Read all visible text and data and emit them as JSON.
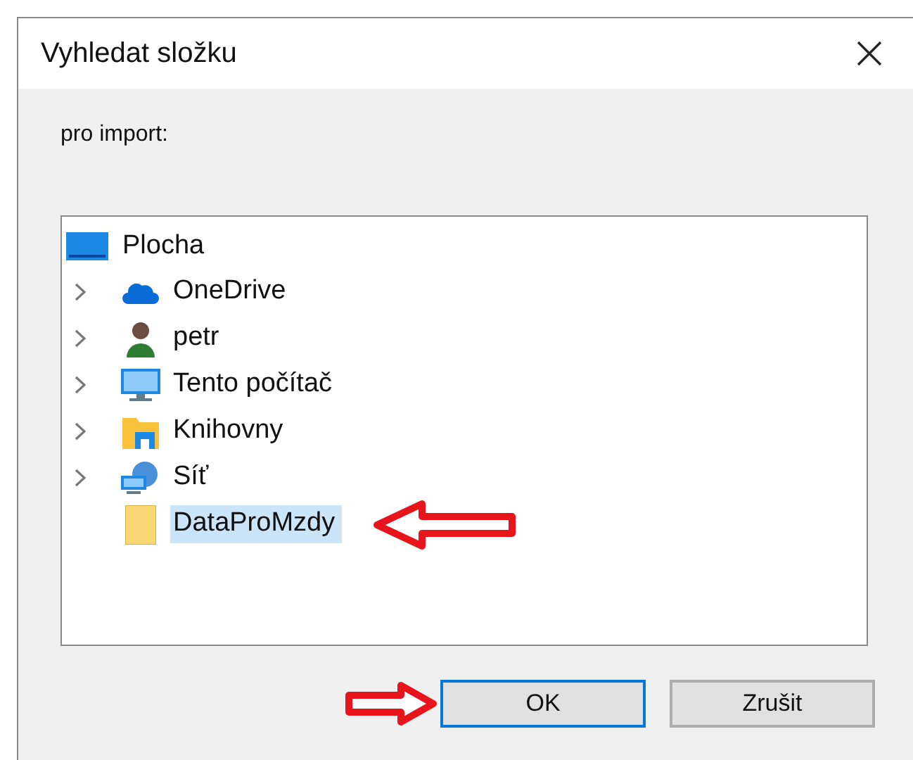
{
  "window": {
    "title": "Vyhledat složku"
  },
  "description": "pro import:",
  "tree": {
    "label": "Plocha",
    "kind": "desktop",
    "selected": false,
    "children": [
      {
        "label": "OneDrive",
        "kind": "cloud",
        "expandable": true,
        "selected": false
      },
      {
        "label": "petr",
        "kind": "user",
        "expandable": true,
        "selected": false
      },
      {
        "label": "Tento počítač",
        "kind": "monitor",
        "expandable": true,
        "selected": false
      },
      {
        "label": "Knihovny",
        "kind": "library",
        "expandable": true,
        "selected": false
      },
      {
        "label": "Síť",
        "kind": "network",
        "expandable": true,
        "selected": false
      },
      {
        "label": "DataProMzdy",
        "kind": "folder",
        "expandable": false,
        "selected": true
      }
    ]
  },
  "buttons": [
    {
      "label": "OK",
      "default": true
    },
    {
      "label": "Zrušit",
      "default": false
    }
  ]
}
